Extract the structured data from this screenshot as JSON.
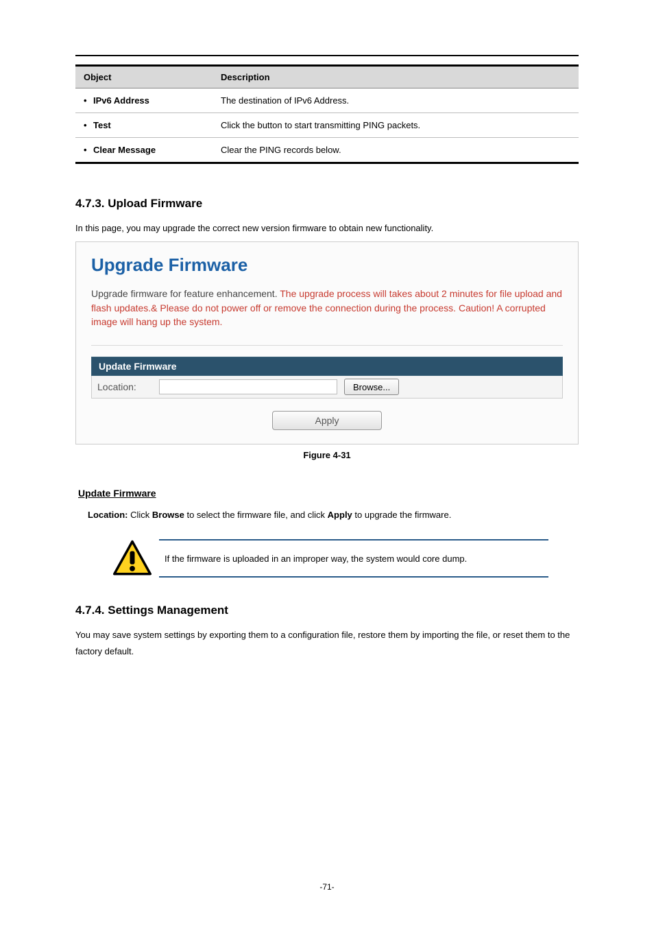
{
  "table": {
    "headers": {
      "object": "Object",
      "description": "Description"
    },
    "rows": [
      {
        "object": "IPv6 Address",
        "description": "The destination of IPv6 Address."
      },
      {
        "object": "Test",
        "description": "Click the button to start transmitting PING packets."
      },
      {
        "object": "Clear Message",
        "description": "Clear the PING records below."
      }
    ]
  },
  "section473": {
    "heading": "4.7.3.  Upload Firmware",
    "intro": "In this page, you may upgrade the correct new version firmware to obtain new functionality."
  },
  "panel": {
    "title": "Upgrade Firmware",
    "desc_pre": "Upgrade firmware for feature enhancement. ",
    "desc_red": "The upgrade process will takes about 2 minutes for file upload and flash updates.& Please do not power off or remove the connection during the process. Caution! A corrupted image will hang up the system.",
    "bar": "Update Firmware",
    "location_label": "Location:",
    "location_value": "",
    "browse_label": "Browse...",
    "apply_label": "Apply"
  },
  "fig_caption": "Figure 4-31",
  "uf_heading": "Update Firmware",
  "loc": {
    "p1": "Location:",
    "p2": " Click ",
    "p3": "Browse",
    "p4": " to select the firmware file, and click ",
    "p5": "Apply",
    "p6": " to upgrade the firmware."
  },
  "note_text": "If the firmware is uploaded in an improper way, the system would core dump.",
  "section474": {
    "heading": "4.7.4.  Settings Management",
    "body": "You may save system settings by exporting them to a configuration file, restore them by importing the file, or reset them to the factory default."
  },
  "page_number": "-71-"
}
